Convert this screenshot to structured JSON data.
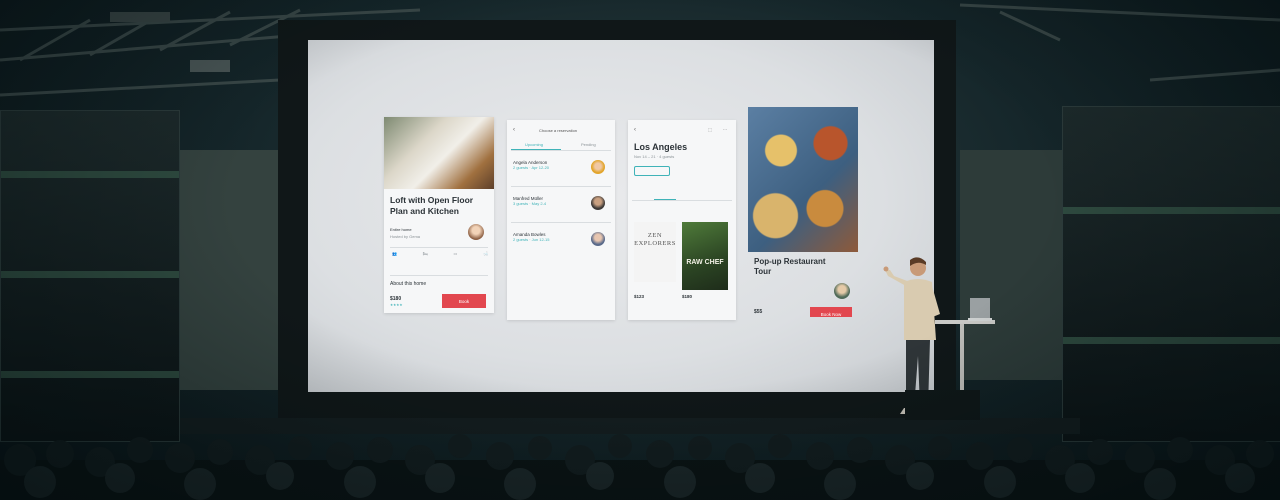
{
  "scene": {
    "description_hint": "",
    "colors": {
      "screen": "#e3e5e7",
      "accent_red": "#e2474f",
      "accent_teal": "#3fb3b8",
      "room_dark": "#0e1a1e"
    }
  },
  "slide": {
    "card1": {
      "title": "Loft with Open Floor Plan and Kitchen",
      "subtitle": "Entire home",
      "host": "Hosted by Gema",
      "section": "About this home",
      "price": "$180",
      "button": "Book"
    },
    "card2": {
      "header": "Choose a reservation",
      "tab_left": "Upcoming",
      "tab_right": "Pending",
      "guests": [
        {
          "name": "Angela Anderson",
          "detail": "2 guests · Apr 12-20"
        },
        {
          "name": "Manfred Müller",
          "detail": "3 guests · May 2-4"
        },
        {
          "name": "Amanda Bowles",
          "detail": "2 guests · Jun 12-15"
        }
      ]
    },
    "card3": {
      "title": "Los Angeles",
      "subtitle": "Nov 14 – 21 · 4 guests",
      "book1_title": "ZEN EXPLORERS",
      "book2_title": "RAW CHEF",
      "price1": "$123",
      "price2": "$180"
    },
    "card4": {
      "title": "Pop-up Restaurant Tour",
      "price": "$55",
      "button": "Book Now"
    }
  }
}
